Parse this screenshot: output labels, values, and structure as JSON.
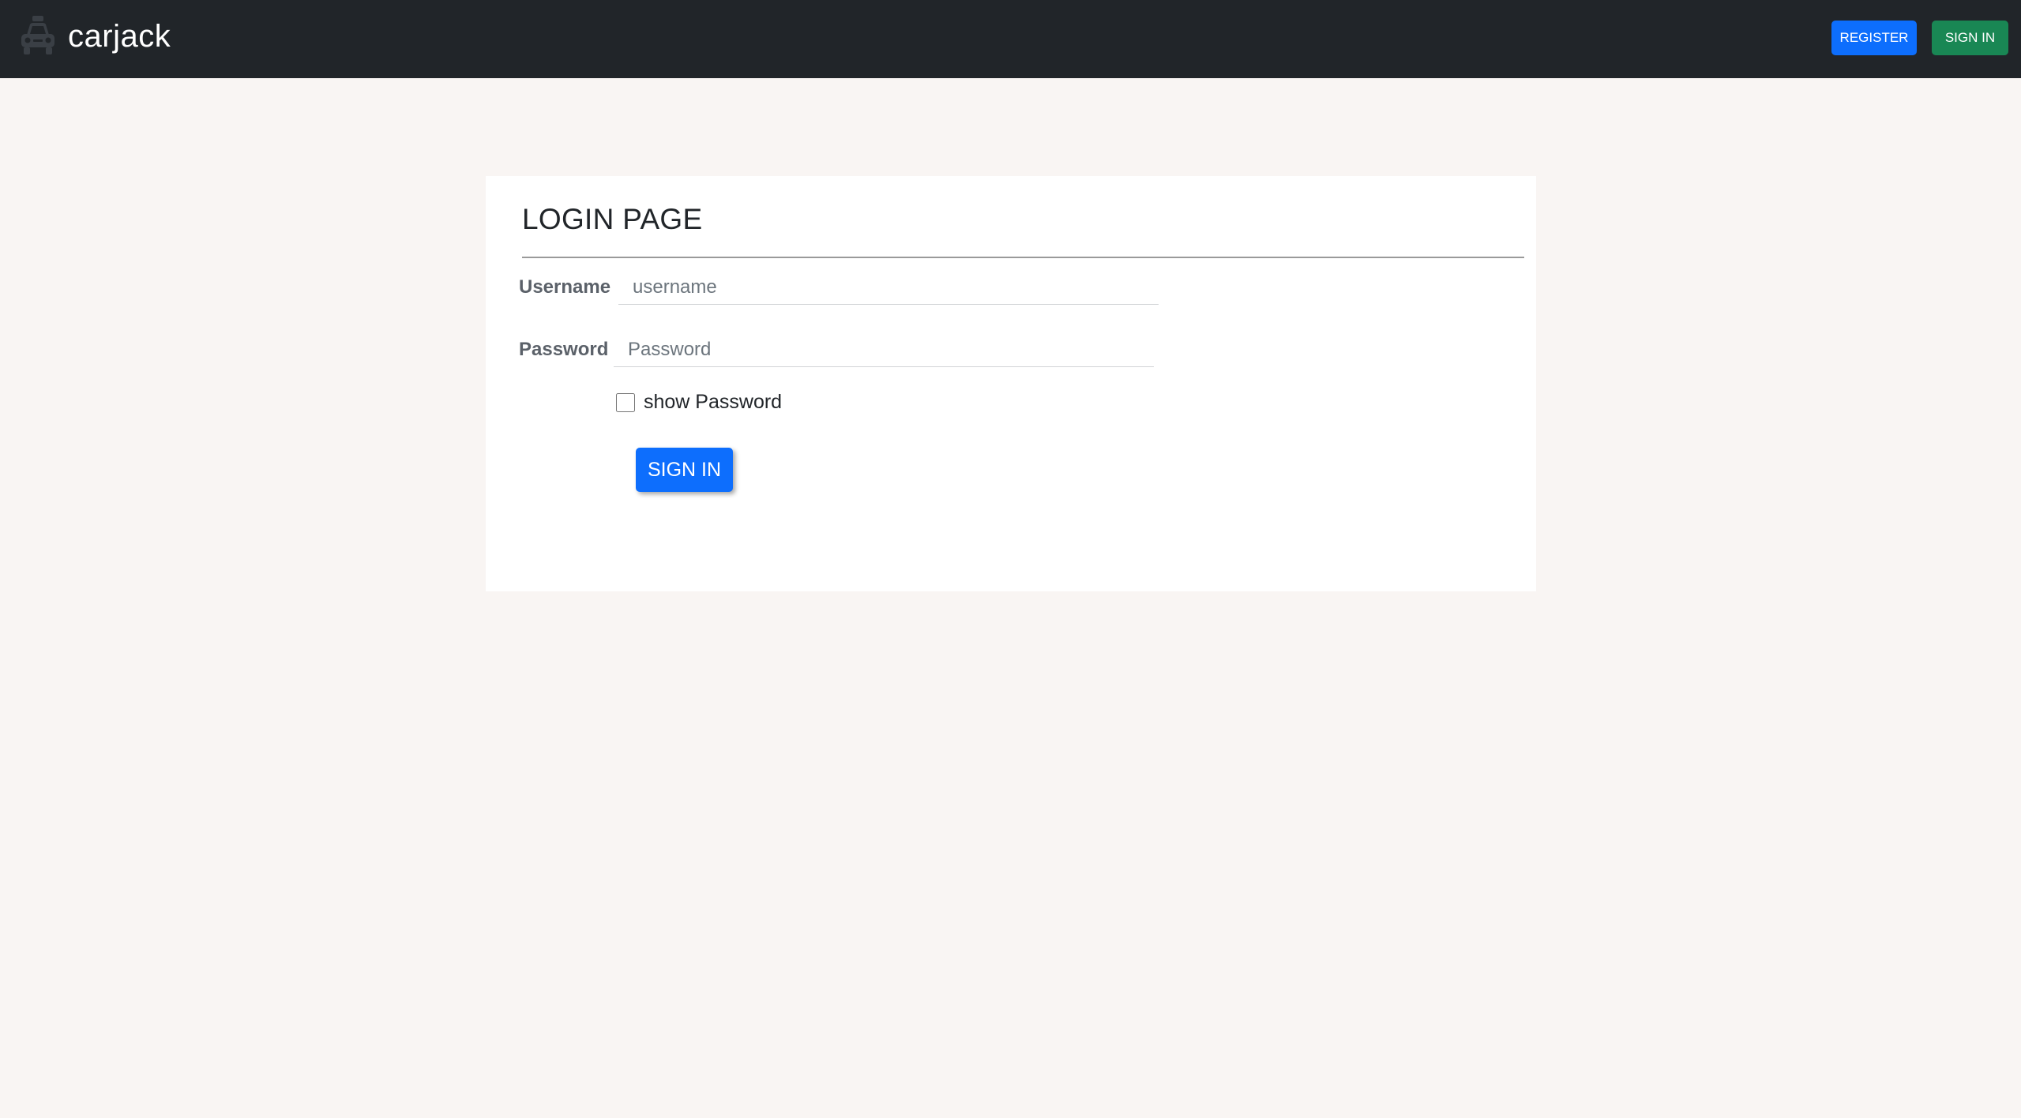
{
  "navbar": {
    "brand_icon": "taxi-car-icon",
    "brand_name": "carjack",
    "register_label": "REGISTER",
    "signin_label": "SIGN IN"
  },
  "login": {
    "title": "LOGIN PAGE",
    "username_label": "Username",
    "username_placeholder": "username",
    "username_value": "",
    "password_label": "Password",
    "password_placeholder": "Password",
    "password_value": "",
    "show_password_label": "show Password",
    "show_password_checked": false,
    "submit_label": "SIGN IN"
  },
  "colors": {
    "navbar_bg": "#212529",
    "page_bg": "#f9f5f3",
    "primary": "#0d6efd",
    "success": "#198754"
  }
}
